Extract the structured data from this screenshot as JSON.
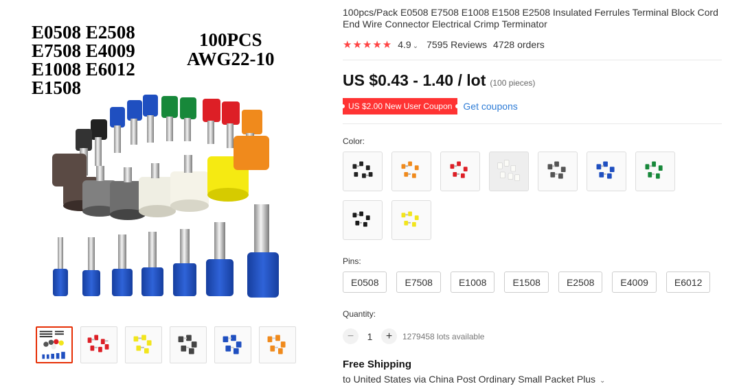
{
  "product": {
    "title": "100pcs/Pack E0508 E7508 E1008 E1508 E2508 Insulated Ferrules Terminal Block Cord End Wire Connector Electrical Crimp Terminator",
    "rating": "4.9",
    "reviews": "7595 Reviews",
    "orders": "4728 orders",
    "price": "US $0.43 - 1.40 / lot",
    "pieces": "(100 pieces)",
    "coupon": "US $2.00 New User Coupon",
    "get_coupons": "Get coupons"
  },
  "image_text": {
    "codes": "E0508 E2508\nE7508 E4009\nE1008 E6012\nE1508",
    "pack": "100PCS\nAWG22-10"
  },
  "color": {
    "label": "Color:",
    "options": [
      {
        "name": "black",
        "insulator": "#222222"
      },
      {
        "name": "orange",
        "insulator": "#f08a1c"
      },
      {
        "name": "red",
        "insulator": "#dd1f26"
      },
      {
        "name": "white",
        "insulator": "#f2f2ee"
      },
      {
        "name": "grey",
        "insulator": "#555555"
      },
      {
        "name": "blue",
        "insulator": "#1f4fc0"
      },
      {
        "name": "green",
        "insulator": "#17883a"
      },
      {
        "name": "black-2",
        "insulator": "#1a1a1a"
      },
      {
        "name": "yellow",
        "insulator": "#f2e51c"
      }
    ]
  },
  "pins": {
    "label": "Pins:",
    "options": [
      "E0508",
      "E7508",
      "E1008",
      "E1508",
      "E2508",
      "E4009",
      "E6012"
    ]
  },
  "quantity": {
    "label": "Quantity:",
    "value": "1",
    "minus": "−",
    "plus": "+",
    "available": "1279458 lots available"
  },
  "shipping": {
    "title": "Free Shipping",
    "detail": "to United States via China Post Ordinary Small Packet Plus"
  },
  "icons": {
    "stars": "★★★★★",
    "chevron": "⌄"
  },
  "colors": {
    "accent": "#e62e04",
    "coupon_bg": "#ff3333",
    "link": "#2e7cd6",
    "star": "#ff4444"
  }
}
